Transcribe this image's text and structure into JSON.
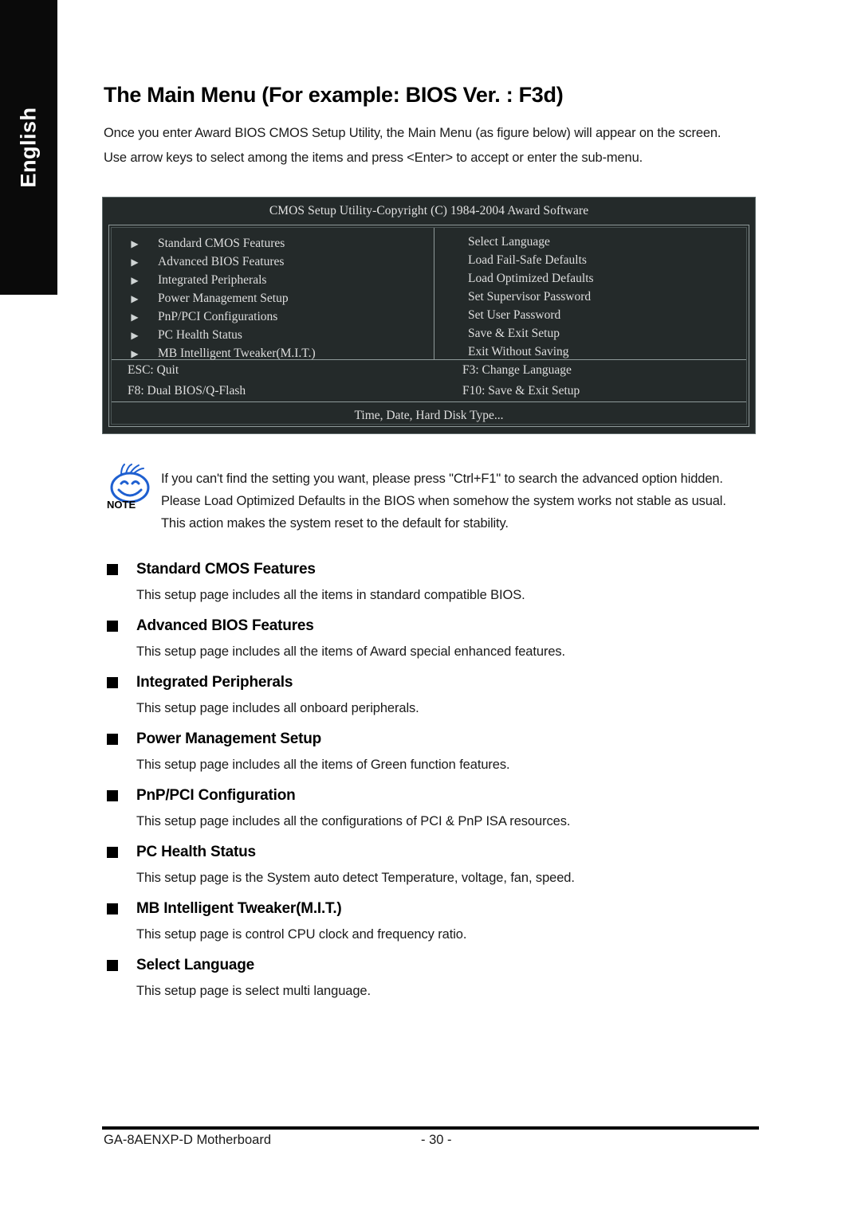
{
  "sidebar": {
    "language_tab": "English"
  },
  "header": {
    "title": "The Main Menu (For example: BIOS Ver. : F3d)",
    "intro_line1": "Once you enter Award BIOS CMOS Setup Utility, the Main Menu (as figure below) will appear on the screen.",
    "intro_line2": "Use arrow keys to select among the items and press <Enter> to accept or enter the sub-menu."
  },
  "bios_screen": {
    "title": "CMOS Setup Utility-Copyright (C) 1984-2004 Award Software",
    "arrow_glyph": "▶",
    "left_items": [
      "Standard CMOS Features",
      "Advanced BIOS Features",
      "Integrated Peripherals",
      "Power Management Setup",
      "PnP/PCI Configurations",
      "PC Health Status",
      "MB Intelligent Tweaker(M.I.T.)"
    ],
    "right_items": [
      "Select Language",
      "Load Fail-Safe Defaults",
      "Load Optimized Defaults",
      "Set Supervisor Password",
      "Set User Password",
      "Save & Exit Setup",
      "Exit Without Saving"
    ],
    "keys": [
      "ESC: Quit",
      "F3: Change Language",
      "F8: Dual BIOS/Q-Flash",
      "F10: Save & Exit Setup"
    ],
    "status_line": "Time, Date, Hard Disk Type...",
    "colors": {
      "background": "#242a2a",
      "border_light": "#8f9a9a",
      "text": "#dedede"
    }
  },
  "note": {
    "icon_label": "NOTE",
    "icon_color": "#1e5fd0",
    "line1": "If you can't find the setting you want, please press \"Ctrl+F1\" to search the advanced option hidden.",
    "line2": "Please Load Optimized Defaults in the BIOS when somehow the system works not stable as usual.",
    "line3": "This action makes the system reset to the default for stability."
  },
  "sections": [
    {
      "title": "Standard CMOS Features",
      "body": "This setup page includes all the items in standard compatible BIOS."
    },
    {
      "title": "Advanced BIOS Features",
      "body": "This setup page includes all the items of Award special enhanced features."
    },
    {
      "title": "Integrated Peripherals",
      "body": "This setup page includes all onboard peripherals."
    },
    {
      "title": "Power Management Setup",
      "body": "This setup page includes all the items of Green function features."
    },
    {
      "title": "PnP/PCI Configuration",
      "body": "This setup page includes all the configurations of PCI & PnP ISA resources."
    },
    {
      "title": "PC Health Status",
      "body": "This setup page is the System auto detect Temperature, voltage, fan, speed."
    },
    {
      "title": "MB Intelligent Tweaker(M.I.T.)",
      "body": "This setup page is control CPU clock and frequency ratio."
    },
    {
      "title": "Select Language",
      "body": "This setup page is select multi language."
    }
  ],
  "footer": {
    "left": "GA-8AENXP-D Motherboard",
    "page_number": "- 30 -"
  }
}
